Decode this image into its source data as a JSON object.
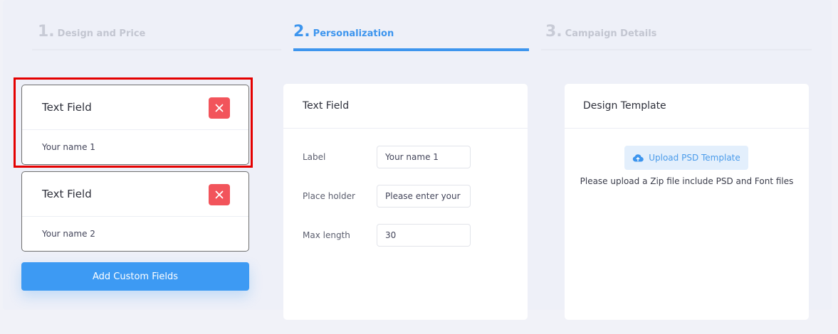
{
  "steps": [
    {
      "number": "1.",
      "label": "Design and Price",
      "active": false
    },
    {
      "number": "2.",
      "label": "Personalization",
      "active": true
    },
    {
      "number": "3.",
      "label": "Campaign Details",
      "active": false
    }
  ],
  "fields": [
    {
      "title": "Text Field",
      "value": "Your name 1",
      "highlighted": true
    },
    {
      "title": "Text Field",
      "value": "Your name 2",
      "highlighted": false
    }
  ],
  "add_button_label": "Add Custom Fields",
  "editor": {
    "title": "Text Field",
    "label_caption": "Label",
    "label_value": "Your name 1",
    "placeholder_caption": "Place holder",
    "placeholder_value": "Please enter your name",
    "maxlength_caption": "Max length",
    "maxlength_value": "30"
  },
  "template": {
    "title": "Design Template",
    "upload_label": "Upload PSD Template",
    "upload_icon": "cloud-upload-icon",
    "hint": "Please upload a Zip file include PSD and Font files"
  },
  "colors": {
    "accent": "#3d95ee",
    "danger": "#f2545b",
    "highlight": "#e40000"
  }
}
